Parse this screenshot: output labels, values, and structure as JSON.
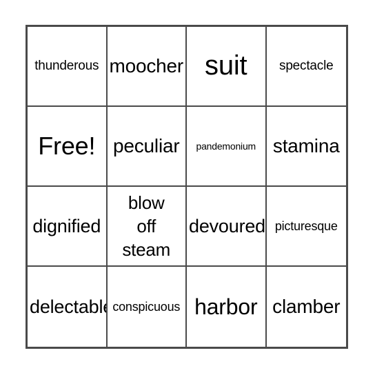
{
  "card": {
    "type": "bingo-card",
    "grid": {
      "rows": 4,
      "columns": 4
    },
    "border_color": "#4a4a4a",
    "text_color": "#000000",
    "background_color": "#ffffff",
    "cells": [
      {
        "row": 1,
        "column": 1,
        "text": "thunderous",
        "size_class": "sz-xs",
        "free_space": false
      },
      {
        "row": 1,
        "column": 2,
        "text": "moocher",
        "size_class": "sz-md",
        "free_space": false
      },
      {
        "row": 1,
        "column": 3,
        "text": "suit",
        "size_class": "sz-xxl",
        "free_space": false
      },
      {
        "row": 1,
        "column": 4,
        "text": "spectacle",
        "size_class": "sz-xs",
        "free_space": false
      },
      {
        "row": 2,
        "column": 1,
        "text": "Free!",
        "size_class": "sz-xl",
        "free_space": true
      },
      {
        "row": 2,
        "column": 2,
        "text": "peculiar",
        "size_class": "sz-md",
        "free_space": false
      },
      {
        "row": 2,
        "column": 3,
        "text": "pandemonium",
        "size_class": "sz-xxs",
        "free_space": false
      },
      {
        "row": 2,
        "column": 4,
        "text": "stamina",
        "size_class": "sz-md",
        "free_space": false
      },
      {
        "row": 3,
        "column": 1,
        "text": "dignified",
        "size_class": "sz-md2",
        "free_space": false
      },
      {
        "row": 3,
        "column": 2,
        "text": "blow\noff\nsteam",
        "size_class": "sz-sm multiline",
        "free_space": false
      },
      {
        "row": 3,
        "column": 3,
        "text": "devoured",
        "size_class": "sz-md2",
        "free_space": false
      },
      {
        "row": 3,
        "column": 4,
        "text": "picturesque",
        "size_class": "sz-xs2",
        "free_space": false
      },
      {
        "row": 4,
        "column": 1,
        "text": "delectable",
        "size_class": "sz-md2",
        "free_space": false
      },
      {
        "row": 4,
        "column": 2,
        "text": "conspicuous",
        "size_class": "sz-xs2",
        "free_space": false
      },
      {
        "row": 4,
        "column": 3,
        "text": "harbor",
        "size_class": "sz-lg",
        "free_space": false
      },
      {
        "row": 4,
        "column": 4,
        "text": "clamber",
        "size_class": "sz-md",
        "free_space": false
      }
    ]
  }
}
